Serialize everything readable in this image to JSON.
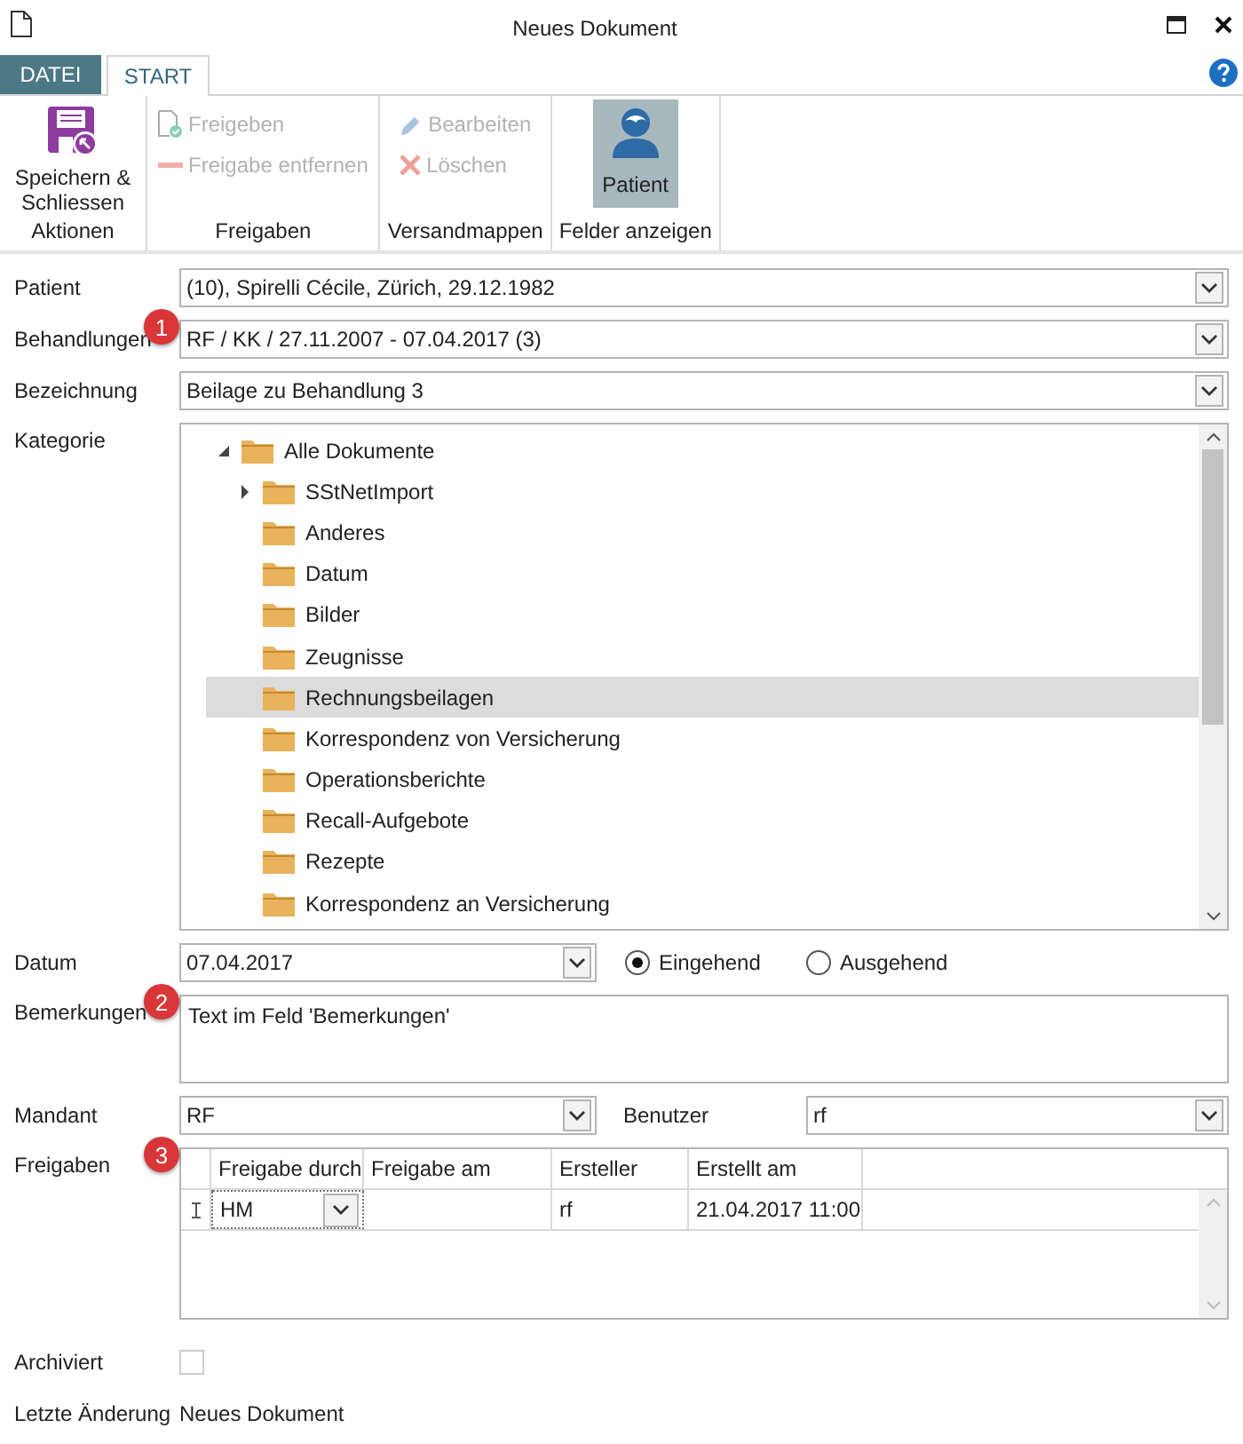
{
  "window": {
    "title": "Neues Dokument"
  },
  "ribbon_tabs": [
    {
      "label": "DATEI",
      "kind": "file",
      "selected": false
    },
    {
      "label": "START",
      "kind": "tab",
      "selected": true
    }
  ],
  "ribbon_groups": [
    {
      "label": "Aktionen",
      "items": [
        {
          "label": "Speichern & Schliessen",
          "kind": "save",
          "selected": false
        }
      ]
    },
    {
      "label": "Freigaben",
      "items": [
        {
          "label": "Freigeben",
          "kind": "approve",
          "disabled": true
        },
        {
          "label": "Freigabe entfernen",
          "kind": "remove",
          "disabled": true
        }
      ]
    },
    {
      "label": "Versandmappen",
      "items": [
        {
          "label": "Bearbeiten",
          "kind": "edit",
          "disabled": true
        },
        {
          "label": "Löschen",
          "kind": "delete",
          "disabled": true
        }
      ]
    },
    {
      "label": "Felder anzeigen",
      "items": [
        {
          "label": "Patient",
          "kind": "patient",
          "selected": true
        }
      ]
    }
  ],
  "form": {
    "patient": {
      "label": "Patient",
      "value": "(10), Spirelli Cécile, Zürich, 29.12.1982"
    },
    "behandlungen": {
      "label": "Behandlungen",
      "value": "RF  / KK / 27.11.2007 - 07.04.2017 (3)",
      "callout": "1"
    },
    "bezeichnung": {
      "label": "Bezeichnung",
      "value": "Beilage zu Behandlung 3"
    },
    "kategorie": {
      "label": "Kategorie",
      "tree": {
        "label": "Alle Dokumente",
        "expanded": true,
        "selected": false,
        "children": [
          {
            "label": "SStNetImport",
            "expandable": true,
            "expanded": false,
            "selected": false
          },
          {
            "label": "Anderes",
            "expandable": false,
            "selected": false
          },
          {
            "label": "Datum",
            "expandable": false,
            "selected": false
          },
          {
            "label": "Bilder",
            "expandable": false,
            "selected": false
          },
          {
            "label": "Zeugnisse",
            "expandable": false,
            "selected": false
          },
          {
            "label": "Rechnungsbeilagen",
            "expandable": false,
            "selected": true
          },
          {
            "label": "Korrespondenz von Versicherung",
            "expandable": false,
            "selected": false
          },
          {
            "label": "Operationsberichte",
            "expandable": false,
            "selected": false
          },
          {
            "label": "Recall-Aufgebote",
            "expandable": false,
            "selected": false
          },
          {
            "label": "Rezepte",
            "expandable": false,
            "selected": false
          },
          {
            "label": "Korrespondenz an Versicherung",
            "expandable": false,
            "selected": false
          }
        ]
      }
    },
    "datum": {
      "label": "Datum",
      "value": "07.04.2017",
      "direction": [
        {
          "label": "Eingehend",
          "selected": true
        },
        {
          "label": "Ausgehend",
          "selected": false
        }
      ]
    },
    "bemerkungen": {
      "label": "Bemerkungen",
      "value": "Text im Feld 'Bemerkungen'",
      "callout": "2"
    },
    "mandant": {
      "label": "Mandant",
      "value": "RF"
    },
    "benutzer": {
      "label": "Benutzer",
      "value": "rf"
    },
    "freigaben": {
      "label": "Freigaben",
      "callout": "3",
      "columns": [
        "Freigabe durch",
        "Freigabe am",
        "Ersteller",
        "Erstellt am"
      ],
      "rows": [
        {
          "freigabe_durch": "HM",
          "ersteller": "rf",
          "erstellt_am": "21.04.2017 11:00",
          "editing": true
        }
      ]
    },
    "archiviert": {
      "label": "Archiviert",
      "checked": false
    },
    "letzte_aenderung": {
      "label": "Letzte Änderung",
      "value": "Neues Dokument"
    }
  }
}
